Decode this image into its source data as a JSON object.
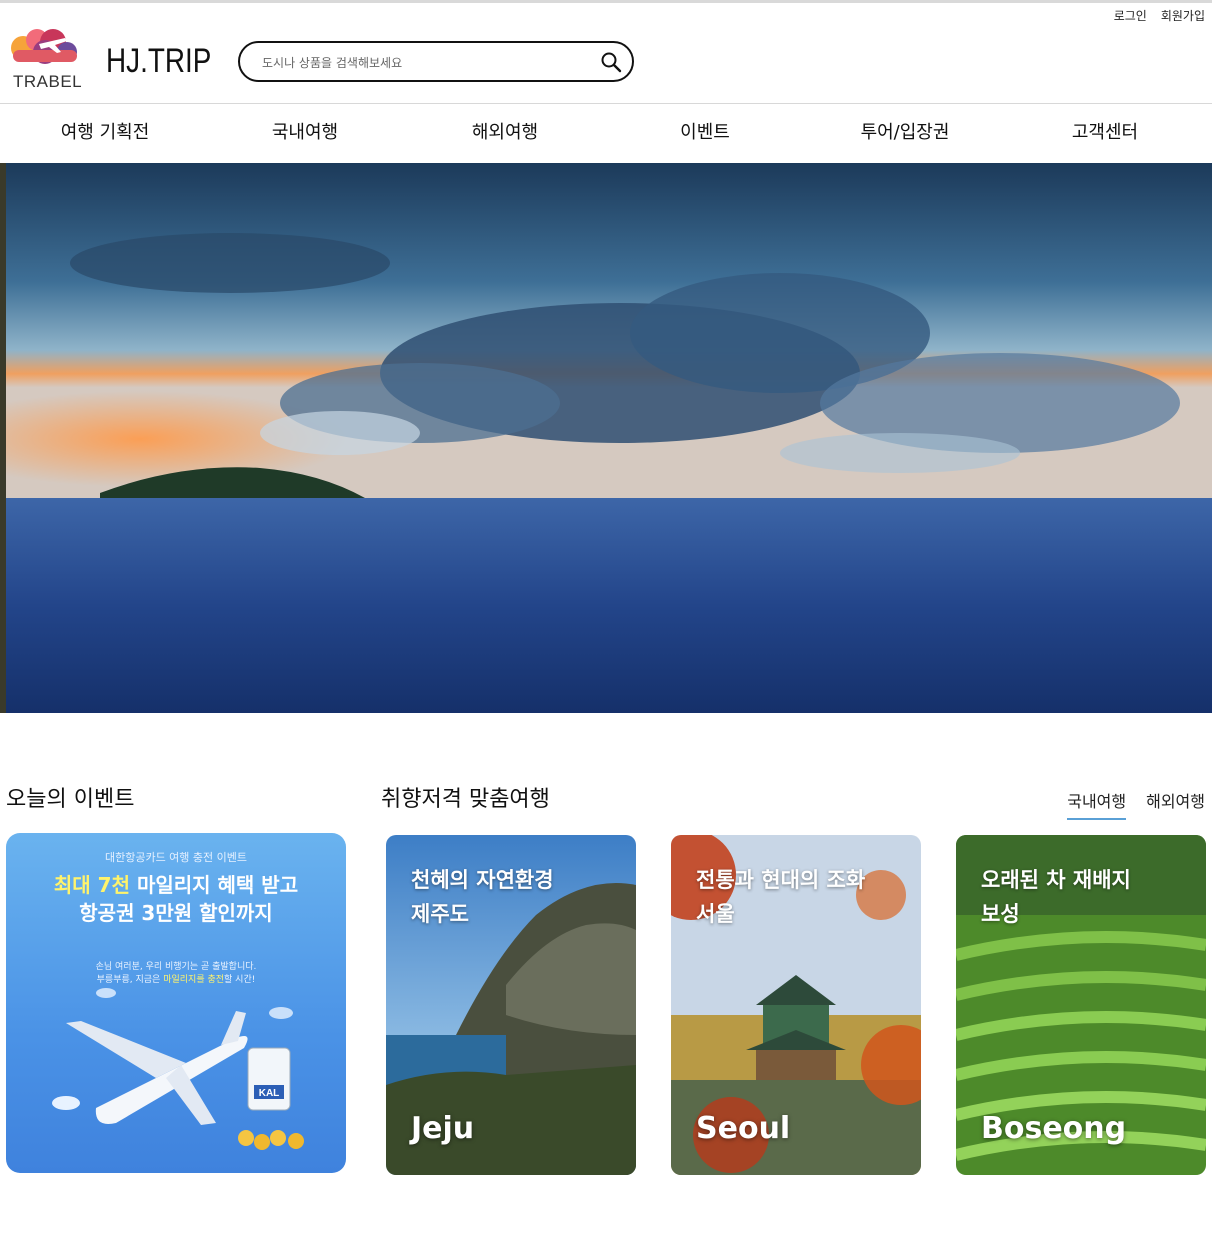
{
  "util_nav": {
    "login": "로그인",
    "signup": "회원가입"
  },
  "logo": {
    "text": "TRABEL"
  },
  "brand": "HJ.TRIP",
  "search": {
    "placeholder": "도시나 상품을 검색해보세요"
  },
  "nav": [
    "여행 기획전",
    "국내여행",
    "해외여행",
    "이벤트",
    "투어/입장권",
    "고객센터"
  ],
  "sections": {
    "events_title": "오늘의 이벤트",
    "custom_title": "취향저격 맞춤여행"
  },
  "tabs": {
    "domestic": "국내여행",
    "overseas": "해외여행"
  },
  "event": {
    "small": "대한항공카드 여행 충전 이벤트",
    "line1_hl": "최대 7천",
    "line1_rest": " 마일리지 혜택 받고",
    "line2": "항공권 3만원 할인까지",
    "desc1": "손님 여러분, 우리 비행기는 곧 출발합니다.",
    "desc2_a": "부릉부릉, 지금은 ",
    "desc2_hl": "마일리지를 충전",
    "desc2_b": "할 시간!",
    "kal": "KAL"
  },
  "destinations": [
    {
      "subtitle": "천혜의 자연환경\n제주도",
      "name": "Jeju"
    },
    {
      "subtitle": "전통과 현대의 조화\n서울",
      "name": "Seoul"
    },
    {
      "subtitle": "오래된 차 재배지\n보성",
      "name": "Boseong"
    }
  ]
}
